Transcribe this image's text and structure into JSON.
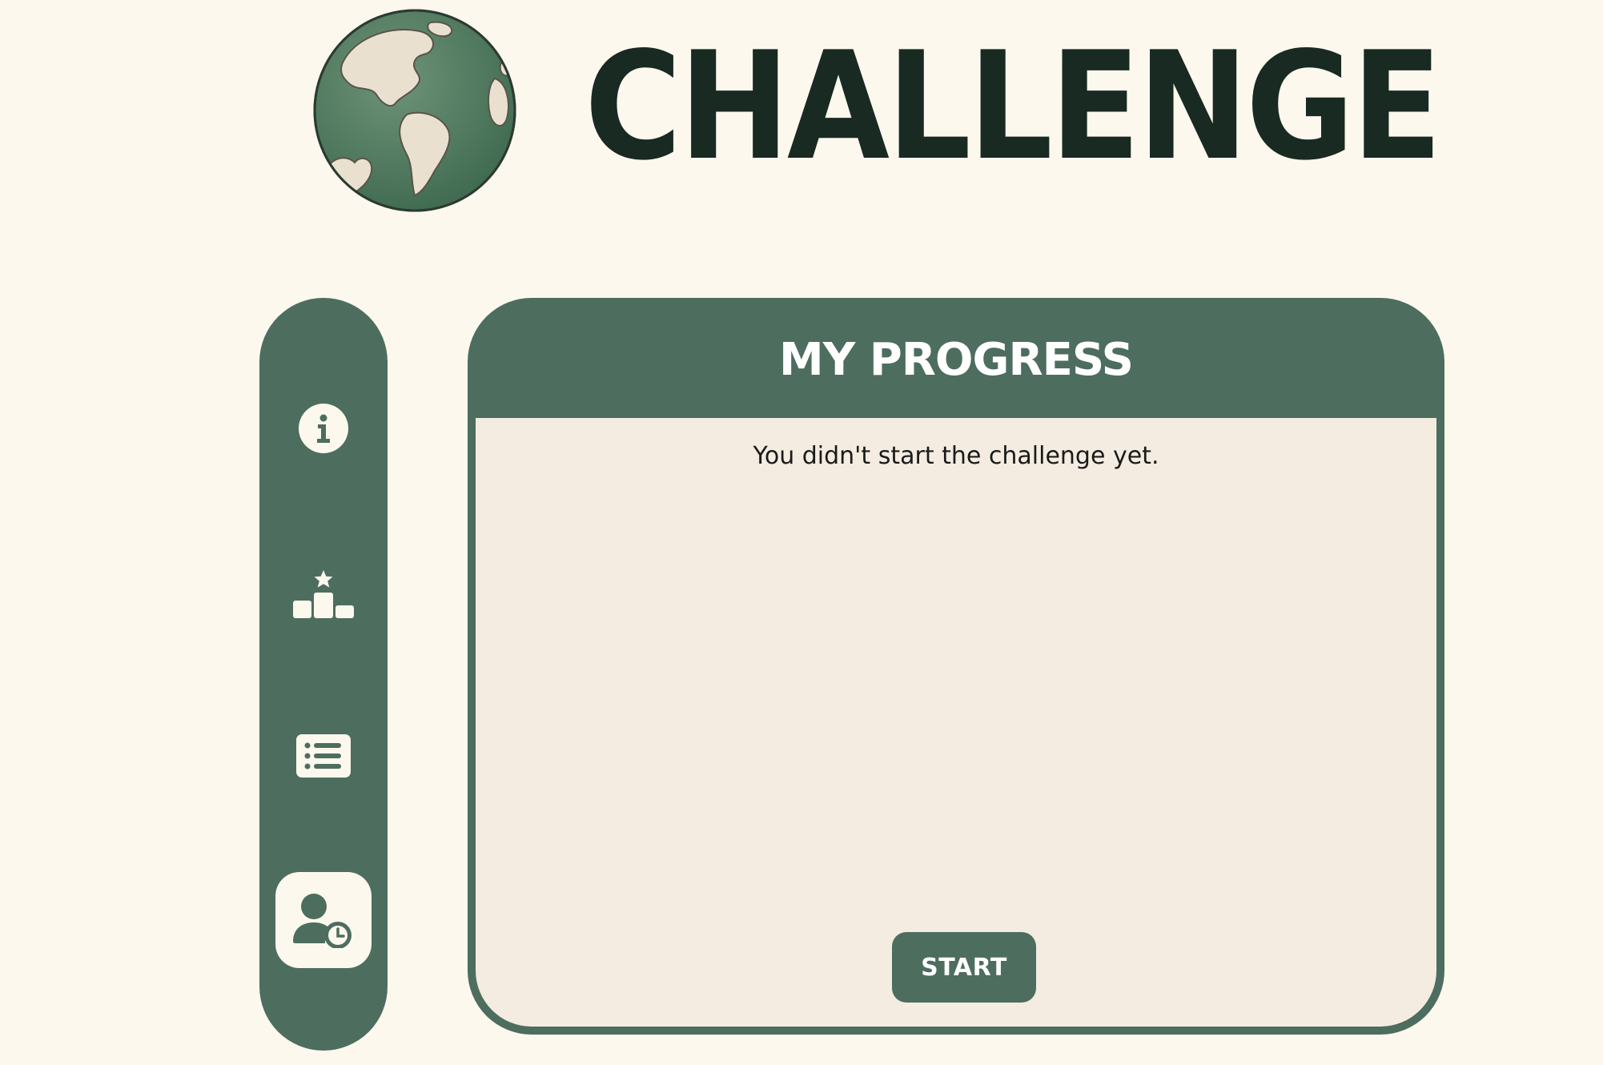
{
  "header": {
    "title": "CHALLENGE",
    "logo_icon": "globe-icon"
  },
  "sidebar": {
    "items": [
      {
        "icon": "info-icon",
        "active": false
      },
      {
        "icon": "podium-star-icon",
        "active": false
      },
      {
        "icon": "list-icon",
        "active": false
      },
      {
        "icon": "user-clock-icon",
        "active": true
      }
    ]
  },
  "panel": {
    "title": "MY PROGRESS",
    "status_text": "You didn't start the challenge yet.",
    "start_label": "START"
  },
  "colors": {
    "background": "#fcf8ee",
    "accent": "#4d6d5f",
    "panel_body": "#f4ece1",
    "title_text": "#182a22"
  }
}
